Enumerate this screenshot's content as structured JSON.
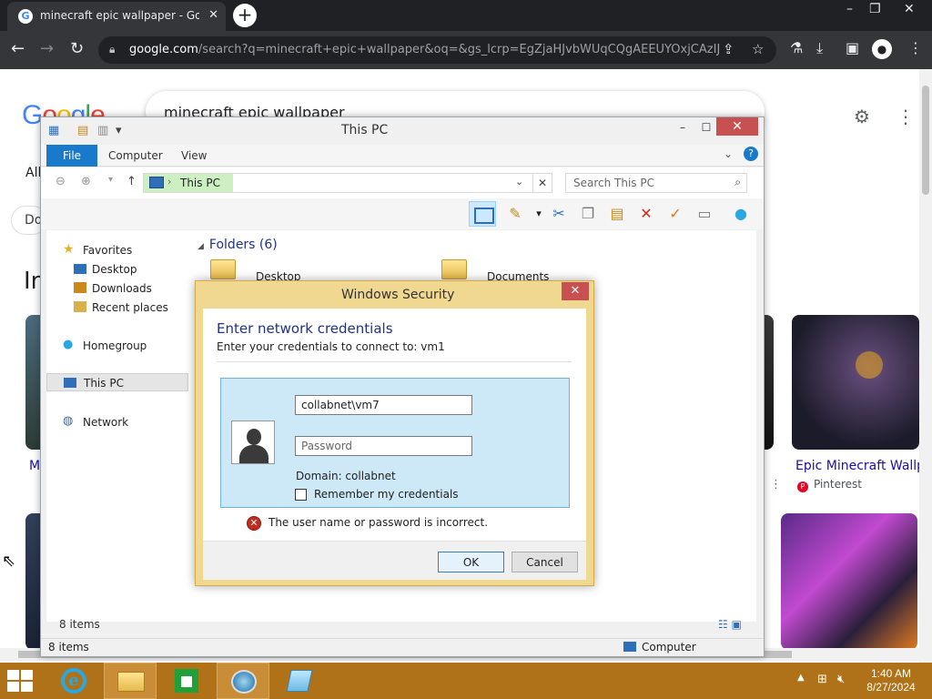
{
  "browser": {
    "tab_title": "minecraft epic wallpaper - Goog",
    "tab_close": "✕",
    "new_tab": "+",
    "url_host": "google.com",
    "url_rest": "/search?q=minecraft+epic+wallpaper&oq=&gs_lcrp=EgZjaHJvbWUqCQgAEEUYOxjCAzIJC...",
    "window_controls": {
      "minimize": "–",
      "restore": "❐",
      "close": "✕"
    }
  },
  "google": {
    "logo": "Google",
    "query": "minecraft epic wallpaper",
    "tab_all": "All",
    "chip_fragment": "Do",
    "heading_fragment": "In",
    "left_caption_fragment": "M",
    "result_caption": "Epic Minecraft Wallpa",
    "result_source": "Pinterest",
    "more": "⋮"
  },
  "explorer": {
    "title": "This PC",
    "ribbon_tabs": {
      "file": "File",
      "computer": "Computer",
      "view": "View"
    },
    "address_location": "This PC",
    "search_placeholder": "Search This PC",
    "nav": {
      "favorites": "Favorites",
      "desktop": "Desktop",
      "downloads": "Downloads",
      "recent": "Recent places",
      "homegroup": "Homegroup",
      "this_pc": "This PC",
      "network": "Network"
    },
    "folders_header": "Folders (6)",
    "folder_partial_1": "Desktop",
    "folder_partial_2": "Documents",
    "status_items_inner": "8 items",
    "status_items": "8 items",
    "status_computer": "Computer"
  },
  "dialog": {
    "title": "Windows Security",
    "close": "✕",
    "heading": "Enter network credentials",
    "subheading": "Enter your credentials to connect to: vm1",
    "username_value": "collabnet\\vm7",
    "password_placeholder": "Password",
    "domain_text": "Domain: collabnet",
    "remember_label": "Remember my credentials",
    "error_message": "The user name or password is incorrect.",
    "ok_label": "OK",
    "cancel_label": "Cancel"
  },
  "taskbar": {
    "time": "1:40 AM",
    "date": "8/27/2024"
  },
  "colors": {
    "taskbar": "#b07218",
    "dialog_frame": "#f0d890",
    "heading_blue": "#1e3287",
    "file_tab": "#1979ca",
    "close_red": "#c75050"
  }
}
